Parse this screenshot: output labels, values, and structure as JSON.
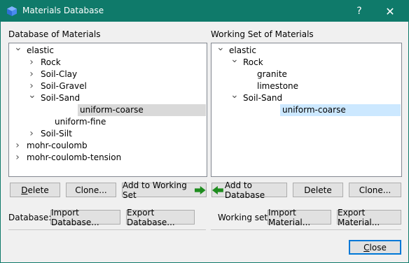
{
  "window": {
    "title": "Materials Database",
    "help": "?",
    "close": "✕"
  },
  "left": {
    "heading": "Database of Materials",
    "tree": [
      {
        "label": "elastic",
        "depth": 0,
        "state": "expanded",
        "sel": ""
      },
      {
        "label": "Rock",
        "depth": 1,
        "state": "collapsed",
        "sel": ""
      },
      {
        "label": "Soil-Clay",
        "depth": 1,
        "state": "collapsed",
        "sel": ""
      },
      {
        "label": "Soil-Gravel",
        "depth": 1,
        "state": "collapsed",
        "sel": ""
      },
      {
        "label": "Soil-Sand",
        "depth": 1,
        "state": "expanded",
        "sel": ""
      },
      {
        "label": "uniform-coarse",
        "depth": 2,
        "state": "leaf",
        "sel": "gray"
      },
      {
        "label": "uniform-fine",
        "depth": 2,
        "state": "leaf",
        "sel": ""
      },
      {
        "label": "Soil-Silt",
        "depth": 1,
        "state": "collapsed",
        "sel": ""
      },
      {
        "label": "mohr-coulomb",
        "depth": 0,
        "state": "collapsed",
        "sel": ""
      },
      {
        "label": "mohr-coulomb-tension",
        "depth": 0,
        "state": "collapsed",
        "sel": ""
      }
    ],
    "delete_label": "Delete",
    "delete_mnemonic": "D",
    "delete_rest": "elete",
    "clone_label": "Clone...",
    "add_label": "Add to Working Set",
    "db_label": "Database:",
    "import_label": "Import Database...",
    "export_label": "Export Database..."
  },
  "right": {
    "heading": "Working Set of Materials",
    "tree": [
      {
        "label": "elastic",
        "depth": 0,
        "state": "expanded",
        "sel": ""
      },
      {
        "label": "Rock",
        "depth": 1,
        "state": "expanded",
        "sel": ""
      },
      {
        "label": "granite",
        "depth": 2,
        "state": "leaf",
        "sel": ""
      },
      {
        "label": "limestone",
        "depth": 2,
        "state": "leaf",
        "sel": ""
      },
      {
        "label": "Soil-Sand",
        "depth": 1,
        "state": "expanded",
        "sel": ""
      },
      {
        "label": "uniform-coarse",
        "depth": 2,
        "state": "leaf",
        "sel": "blue"
      }
    ],
    "add_label": "Add to Database",
    "delete_label": "Delete",
    "clone_label": "Clone...",
    "ws_label": "Working set:",
    "import_label": "Import Material...",
    "export_label": "Export Material..."
  },
  "footer": {
    "close_label": "Close"
  },
  "colors": {
    "titlebar": "#0f7a6a",
    "arrow": "#1e8c1e"
  },
  "icons": {
    "app": "cube-icon",
    "expanded": "chevron-down-icon",
    "collapsed": "chevron-right-icon"
  }
}
